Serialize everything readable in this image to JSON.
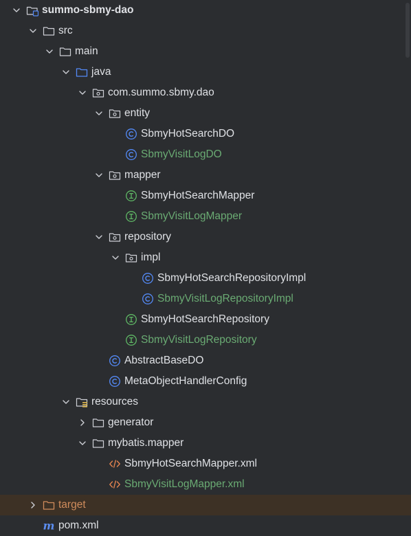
{
  "tree": {
    "root_label": "summo-sbmy-dao",
    "src_label": "src",
    "main_label": "main",
    "java_label": "java",
    "package_label": "com.summo.sbmy.dao",
    "entity_label": "entity",
    "entity_hot_search_do": "SbmyHotSearchDO",
    "entity_visit_log_do": "SbmyVisitLogDO",
    "mapper_label": "mapper",
    "mapper_hot_search": "SbmyHotSearchMapper",
    "mapper_visit_log": "SbmyVisitLogMapper",
    "repository_label": "repository",
    "impl_label": "impl",
    "impl_hot_search": "SbmyHotSearchRepositoryImpl",
    "impl_visit_log": "SbmyVisitLogRepositoryImpl",
    "repo_hot_search": "SbmyHotSearchRepository",
    "repo_visit_log": "SbmyVisitLogRepository",
    "abstract_base_do": "AbstractBaseDO",
    "meta_object_handler": "MetaObjectHandlerConfig",
    "resources_label": "resources",
    "generator_label": "generator",
    "mybatis_mapper_label": "mybatis.mapper",
    "xml_hot_search": "SbmyHotSearchMapper.xml",
    "xml_visit_log": "SbmyVisitLogMapper.xml",
    "target_label": "target",
    "pom_label": "pom.xml"
  },
  "icons": {
    "module": "module-folder-icon",
    "folder": "folder-icon",
    "source_root": "source-root-folder-icon",
    "package": "package-icon",
    "class": "class-icon",
    "interface": "interface-icon",
    "resources_root": "resources-root-folder-icon",
    "xml": "xml-file-icon",
    "excluded": "excluded-folder-icon",
    "maven": "maven-icon"
  },
  "colors": {
    "background": "#2b2d30",
    "text": "#dfe1e5",
    "new_file": "#6aab73",
    "excluded": "#d08c5c",
    "excluded_row": "#3d3125",
    "class_icon": "#548af7",
    "interface_icon": "#5fb865",
    "source_root_icon": "#548af7",
    "maven_icon": "#5b8def"
  }
}
